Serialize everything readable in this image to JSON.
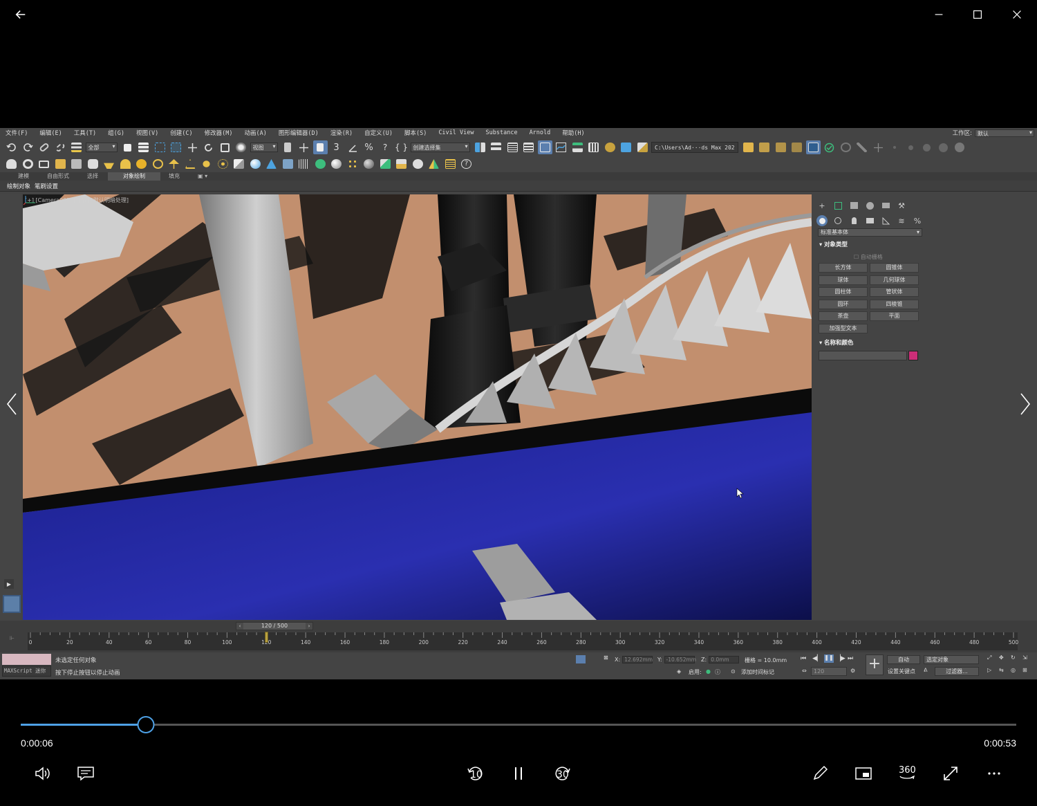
{
  "player": {
    "current_time": "0:00:06",
    "total_time": "0:00:53",
    "progress": 0.1255,
    "skip_back_label": "10",
    "skip_forward_label": "30",
    "vr_label": "360",
    "accent_color": "#4ea1e6"
  },
  "max": {
    "menu": [
      "文件(F)",
      "编辑(E)",
      "工具(T)",
      "组(G)",
      "视图(V)",
      "创建(C)",
      "修改器(M)",
      "动画(A)",
      "图形编辑器(D)",
      "渲染(R)",
      "自定义(U)",
      "脚本(S)",
      "Civil View",
      "Substance",
      "Arnold",
      "帮助(H)"
    ],
    "workspace_label": "工作区:",
    "workspace_value": "默认",
    "toolbar": {
      "filter_value": "全部",
      "coord_value": "视图",
      "selection_set": "创建选择集",
      "project_path": "C:\\Users\\Ad···ds Max 202"
    },
    "ribbon_tabs": [
      "建模",
      "自由形式",
      "选择",
      "对象绘制",
      "填充"
    ],
    "ribbon_active": "对象绘制",
    "ribbon_sub": [
      "绘制对象",
      "笔刷设置"
    ],
    "viewport_label": "[+] [Camera001] [标准] [默认明暗处理]",
    "command_panel": {
      "category": "标准基本体",
      "section_object_type": "对象类型",
      "auto_grid": "自动栅格",
      "buttons": [
        "长方体",
        "圆锥体",
        "球体",
        "几何球体",
        "圆柱体",
        "管状体",
        "圆环",
        "四棱锥",
        "茶壶",
        "平面",
        "加强型文本"
      ],
      "section_name_color": "名称和颜色",
      "object_color": "#cc2e78"
    },
    "time_slider": "120 / 500",
    "ruler_ticks": [
      "0",
      "20",
      "40",
      "60",
      "80",
      "100",
      "120",
      "140",
      "160",
      "180",
      "200",
      "220",
      "240",
      "260",
      "280",
      "300",
      "320",
      "340",
      "360",
      "380",
      "400",
      "420",
      "440",
      "460",
      "480",
      "500"
    ],
    "current_frame": 120,
    "total_frames": 500,
    "status": {
      "line1": "未选定任何对象",
      "line2": "按下停止按钮以停止动画",
      "maxscript": "MAXScript 迷你",
      "x_label": "X:",
      "x_value": "12.692mm",
      "y_label": "Y:",
      "y_value": "-10.652mm",
      "z_label": "Z:",
      "z_value": "0.0mm",
      "grid": "栅格 = 10.0mm",
      "enable_label": "启用:",
      "add_time_tag": "添加时间标记",
      "auto_key": "自动",
      "selected_object": "选定对象",
      "set_key": "设置关键点",
      "filters": "过滤器...",
      "frame_field": "120"
    }
  }
}
